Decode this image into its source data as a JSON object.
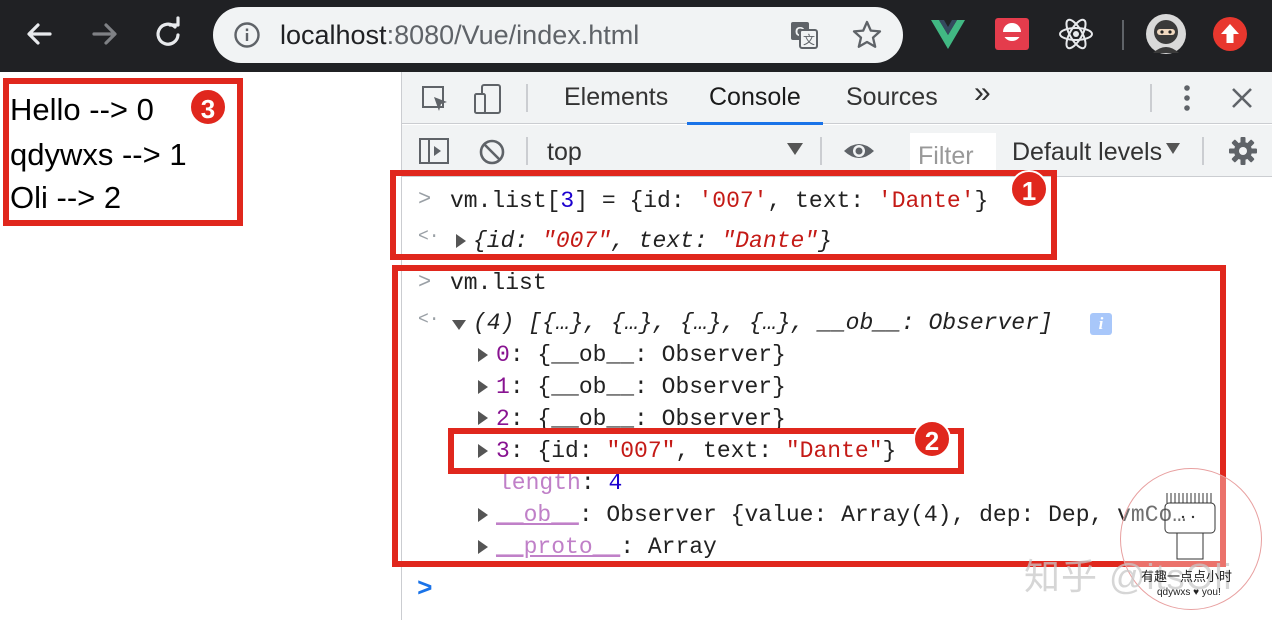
{
  "browser": {
    "url_host": "localhost",
    "url_path": ":8080/Vue/index.html"
  },
  "page": {
    "lines": [
      "Hello --> 0",
      "qdywxs --> 1",
      "Oli --> 2"
    ]
  },
  "devtools": {
    "tabs": [
      "Elements",
      "Console",
      "Sources",
      "»"
    ],
    "active_tab": "Console",
    "context": "top",
    "filter_placeholder": "Filter",
    "levels": "Default levels"
  },
  "console": {
    "cmd1": {
      "prefix": "vm.list[",
      "index": "3",
      "mid": "] = {id: ",
      "id_str": "'007'",
      "sep": ", text: ",
      "text_str": "'Dante'",
      "end": "}"
    },
    "result1": {
      "open": "{id: ",
      "id_str": "\"007\"",
      "sep": ", text: ",
      "text_str": "\"Dante\"",
      "end": "}"
    },
    "cmd2": "vm.list",
    "array_summary": "(4) [{…}, {…}, {…}, {…}, __ob__: Observer]",
    "items": [
      {
        "key": "0",
        "value": ": {__ob__: Observer}"
      },
      {
        "key": "1",
        "value": ": {__ob__: Observer}"
      },
      {
        "key": "2",
        "value": ": {__ob__: Observer}"
      }
    ],
    "item3": {
      "key": "3",
      "open": ": {id: ",
      "id_str": "\"007\"",
      "sep": ", text: ",
      "text_str": "\"Dante\"",
      "end": "}"
    },
    "length_key": "length",
    "length_value": "4",
    "ob_key": "__ob__",
    "ob_value": ": Observer {value: Array(4), dep: Dep, vmCo…",
    "proto_key": "__proto__",
    "proto_value": ": Array"
  },
  "badges": [
    "1",
    "2",
    "3"
  ],
  "watermark": {
    "text": "知乎 @itsOli",
    "sub_cn": "有趣一点点小时",
    "sub": "qdywxs ♥ you!"
  },
  "colors": {
    "highlight": "#e0271d",
    "string": "#c41a16",
    "key": "#881391",
    "number": "#1c00cf",
    "chrome_bar": "#202124"
  }
}
